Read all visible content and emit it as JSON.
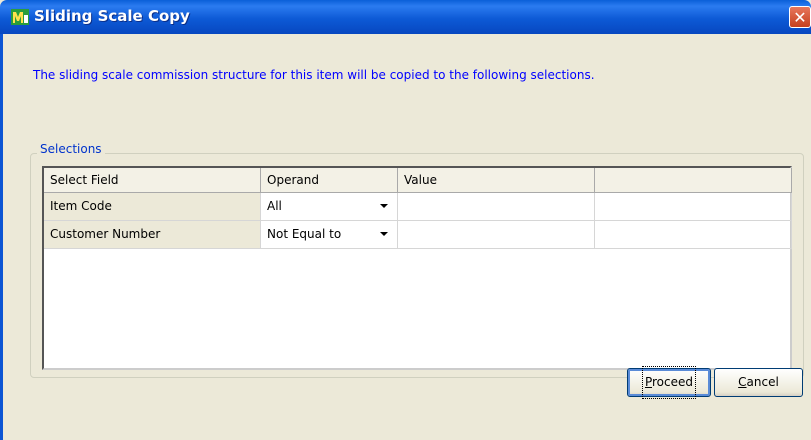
{
  "window": {
    "title": "Sliding Scale Copy",
    "close_glyph": "✕"
  },
  "message": "The sliding scale commission structure for this item will be copied  to the following selections.",
  "selections": {
    "group_label": "Selections",
    "columns": [
      "Select Field",
      "Operand",
      "Value",
      ""
    ],
    "rows": [
      {
        "field": "Item Code",
        "operand": "All",
        "value": "",
        "extra": ""
      },
      {
        "field": "Customer Number",
        "operand": "Not Equal to",
        "value": "",
        "extra": ""
      }
    ]
  },
  "buttons": {
    "proceed": {
      "first": "P",
      "rest": "roceed"
    },
    "cancel": {
      "first": "C",
      "rest": "ancel"
    }
  },
  "icons": {
    "app": "app-icon",
    "close": "close-icon",
    "dropdown": "dropdown-arrow-icon"
  },
  "colors": {
    "title_bar": "#0a5fd8",
    "message_text": "#0000ff",
    "window_bg": "#ece9d8",
    "close_button": "#c5401e"
  }
}
